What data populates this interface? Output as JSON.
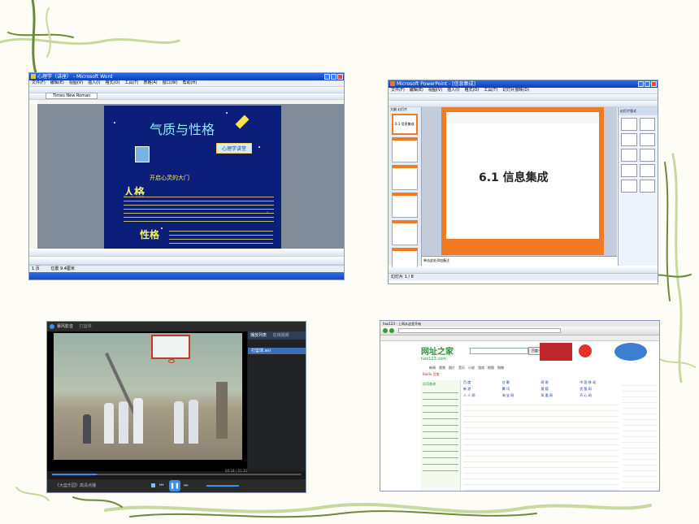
{
  "word": {
    "title": "心理学（讲座） - Microsoft Word",
    "menu": [
      "文件(F)",
      "编辑(E)",
      "视图(V)",
      "插入(I)",
      "格式(O)",
      "工具(T)",
      "表格(A)",
      "窗口(W)",
      "帮助(H)"
    ],
    "font_name": "Times New Roman",
    "doc_heading": "气质与性格",
    "banner": "心理学讲堂",
    "subtitle": "开启心灵的大门",
    "section1": "人格",
    "section2": "性格",
    "status_page": "1 页",
    "status_position": "位置 9.4厘米"
  },
  "ppt": {
    "title": "Microsoft PowerPoint - [信息集成]",
    "menu": [
      "文件(F)",
      "编辑(E)",
      "视图(V)",
      "插入(I)",
      "格式(O)",
      "工具(T)",
      "幻灯片放映(D)",
      "窗口(W)",
      "帮助(H)"
    ],
    "tabs": [
      "大纲",
      "幻灯片"
    ],
    "slide_title": "6.1   信息集成",
    "thumb_label": "6.1 信息集成",
    "notes_placeholder": "单击此处添加备注",
    "status_slide": "幻灯片 1 / 8",
    "pane_title": "幻灯片版式"
  },
  "player": {
    "title": "暴风影音",
    "file": "打篮球",
    "time": "00:18 / 01:35",
    "playlist_tab_1": "播放列表",
    "playlist_tab_2": "在线视频",
    "playlist_item": "打篮球.avi",
    "bottom_label": "《大篮乐园》高清点播"
  },
  "browser": {
    "title": "hao123 - 上网从这里开始",
    "site_logo": "网址之家",
    "site_logo_sub": "hao123.com",
    "search_button": "百度一下",
    "search_engine": "Baidu 百度",
    "nav": [
      "新闻",
      "视频",
      "图片",
      "音乐",
      "小说",
      "游戏",
      "地图",
      "购物"
    ],
    "sidebar_heading": "实用查询",
    "link_columns": [
      [
        "百 度",
        "新 浪",
        "人 人 网"
      ],
      [
        "谷 歌",
        "腾 讯",
        "淘 宝 网"
      ],
      [
        "网 易",
        "搜 狐",
        "凤 凰 网"
      ],
      [
        "中 国 移 动",
        "优 酷 网",
        "开 心 网"
      ]
    ]
  },
  "colors": {
    "vine_green": "#6b8a3a",
    "vine_light": "#c8d9a0",
    "xp_blue": "#0a3fb8",
    "ppt_orange": "#f07b22",
    "doc_navy": "#0b1f7a"
  }
}
